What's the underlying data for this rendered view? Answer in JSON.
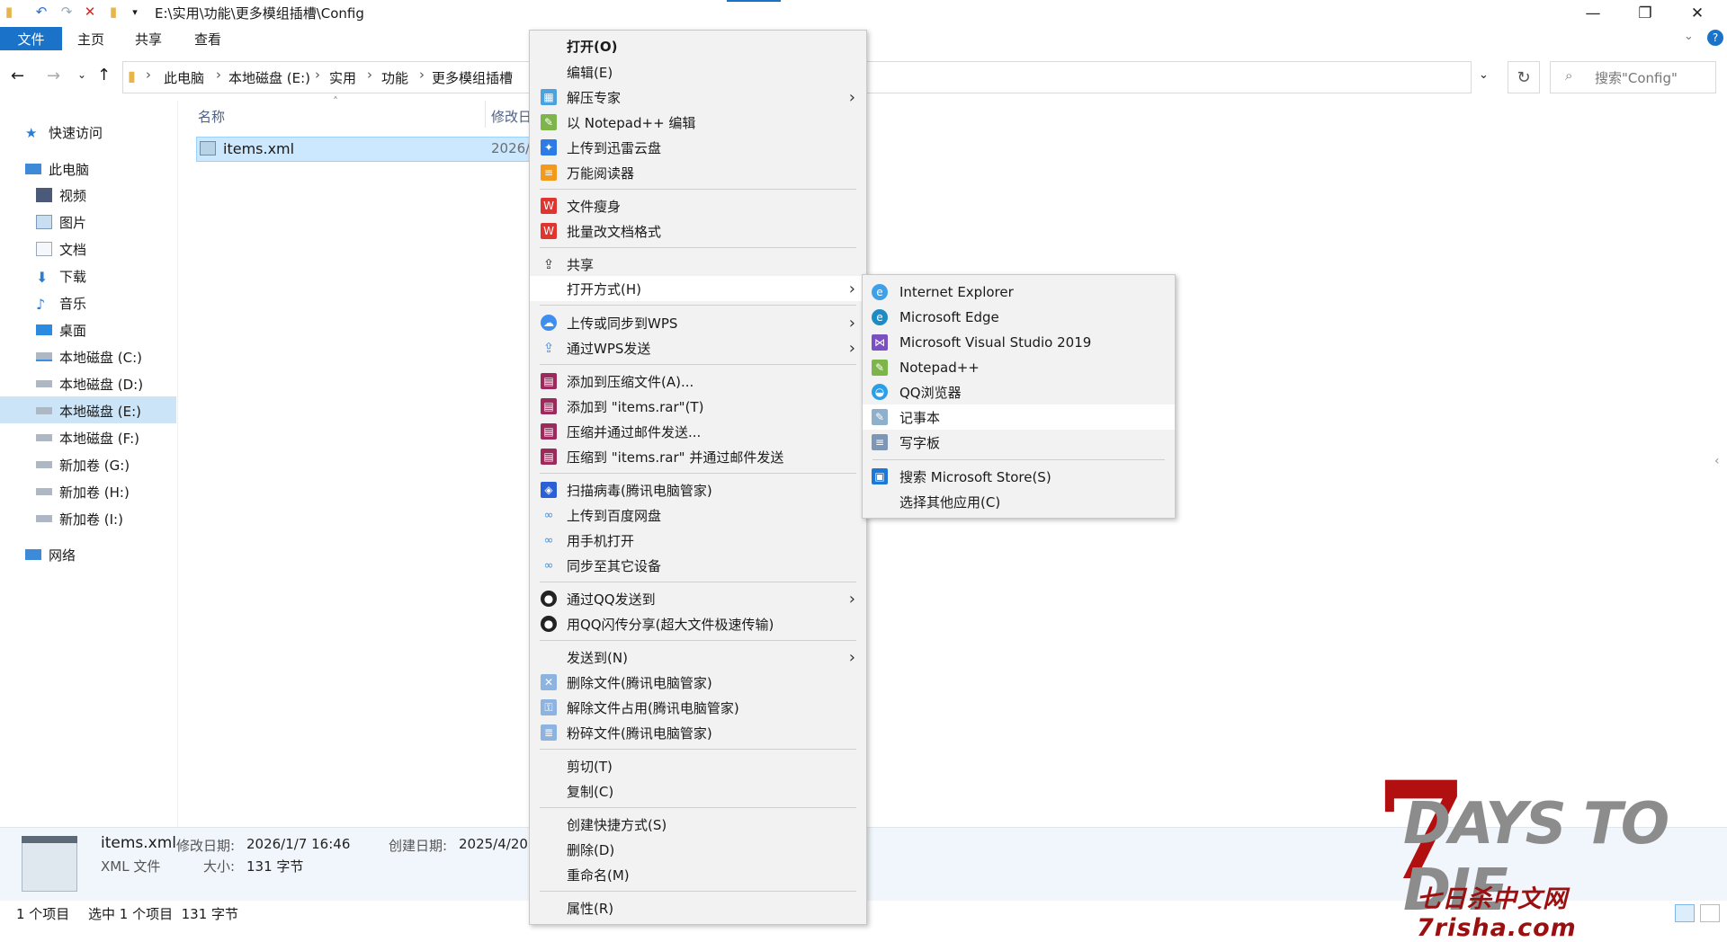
{
  "window": {
    "path": "E:\\实用\\功能\\更多模组插槽\\Config",
    "controls": [
      "minimize",
      "maximize",
      "close"
    ]
  },
  "ribbon": {
    "tabs": [
      "文件",
      "主页",
      "共享",
      "查看"
    ]
  },
  "breadcrumb": [
    "此电脑",
    "本地磁盘 (E:)",
    "实用",
    "功能",
    "更多模组插槽"
  ],
  "search": {
    "placeholder": "搜索\"Config\""
  },
  "sidebar": {
    "quick_access": "快速访问",
    "this_pc": "此电脑",
    "items": [
      "视频",
      "图片",
      "文档",
      "下载",
      "音乐",
      "桌面",
      "本地磁盘 (C:)",
      "本地磁盘 (D:)",
      "本地磁盘 (E:)",
      "本地磁盘 (F:)",
      "新加卷 (G:)",
      "新加卷 (H:)",
      "新加卷 (I:)"
    ],
    "network": "网络",
    "selected": "本地磁盘 (E:)"
  },
  "filelist": {
    "col_name": "名称",
    "col_modified": "修改日",
    "files": [
      {
        "name": "items.xml",
        "modified": "2026/"
      }
    ]
  },
  "details": {
    "name": "items.xml",
    "type": "XML 文件",
    "modified_label": "修改日期:",
    "modified_value": "2026/1/7 16:46",
    "created_label": "创建日期:",
    "created_value": "2025/4/20",
    "size_label": "大小:",
    "size_value": "131 字节"
  },
  "status": {
    "count": "1 个项目",
    "selected": "选中 1 个项目  131 字节"
  },
  "context_menu": {
    "groups": [
      [
        "打开(O)",
        "编辑(E)",
        "解压专家",
        "以 Notepad++ 编辑",
        "上传到迅雷云盘",
        "万能阅读器"
      ],
      [
        "文件瘦身",
        "批量改文档格式"
      ],
      [
        "共享",
        "打开方式(H)"
      ],
      [
        "上传或同步到WPS",
        "通过WPS发送"
      ],
      [
        "添加到压缩文件(A)...",
        "添加到 \"items.rar\"(T)",
        "压缩并通过邮件发送...",
        "压缩到 \"items.rar\" 并通过邮件发送"
      ],
      [
        "扫描病毒(腾讯电脑管家)",
        "上传到百度网盘",
        "用手机打开",
        "同步至其它设备"
      ],
      [
        "通过QQ发送到",
        "用QQ闪传分享(超大文件极速传输)"
      ],
      [
        "发送到(N)",
        "删除文件(腾讯电脑管家)",
        "解除文件占用(腾讯电脑管家)",
        "粉碎文件(腾讯电脑管家)"
      ],
      [
        "剪切(T)",
        "复制(C)"
      ],
      [
        "创建快捷方式(S)",
        "删除(D)",
        "重命名(M)"
      ],
      [
        "属性(R)"
      ]
    ],
    "highlighted": "打开方式(H)"
  },
  "open_with_menu": {
    "apps": [
      "Internet Explorer",
      "Microsoft Edge",
      "Microsoft Visual Studio 2019",
      "Notepad++",
      "QQ浏览器",
      "记事本",
      "写字板"
    ],
    "extra": [
      "搜索 Microsoft Store(S)",
      "选择其他应用(C)"
    ],
    "highlighted": "记事本"
  },
  "watermark": {
    "title": "DAYS TO DIE",
    "numeral": "7",
    "subtitle": "七日杀中文网7risha.com"
  },
  "colors": {
    "accent": "#1a73c9",
    "selection": "#cce8ff",
    "menu_bg": "#f2f2f2",
    "watermark_red": "#b21010"
  }
}
